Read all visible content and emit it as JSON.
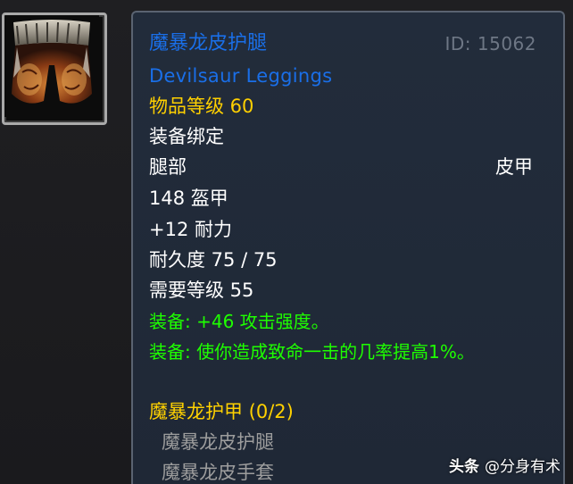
{
  "item": {
    "name_cn": "魔暴龙皮护腿",
    "name_en": "Devilsaur Leggings",
    "id_text": "ID: 15062",
    "item_level": "物品等级 60",
    "binding": "装备绑定",
    "slot": "腿部",
    "armor_type": "皮甲",
    "armor": "148 盔甲",
    "stamina": "+12 耐力",
    "durability": "耐久度 75 / 75",
    "required_level": "需要等级 55",
    "equip_effects": [
      "装备: +46 攻击强度。",
      "装备: 使你造成致命一击的几率提高1%。"
    ],
    "set": {
      "name": "魔暴龙护甲 (0/2)",
      "pieces": [
        "魔暴龙皮护腿",
        "魔暴龙皮手套"
      ]
    },
    "icon": "leather-leggings-icon"
  },
  "watermark": {
    "brand": "头条",
    "handle": "@分身有术"
  },
  "colors": {
    "epic_name": "#1a6fe8",
    "item_level": "#ffd000",
    "equip": "#1eff00",
    "set_name": "#ffd100",
    "set_piece_missing": "#9d9d9d",
    "tooltip_bg": "#202a38",
    "tooltip_border": "#5a6371"
  }
}
